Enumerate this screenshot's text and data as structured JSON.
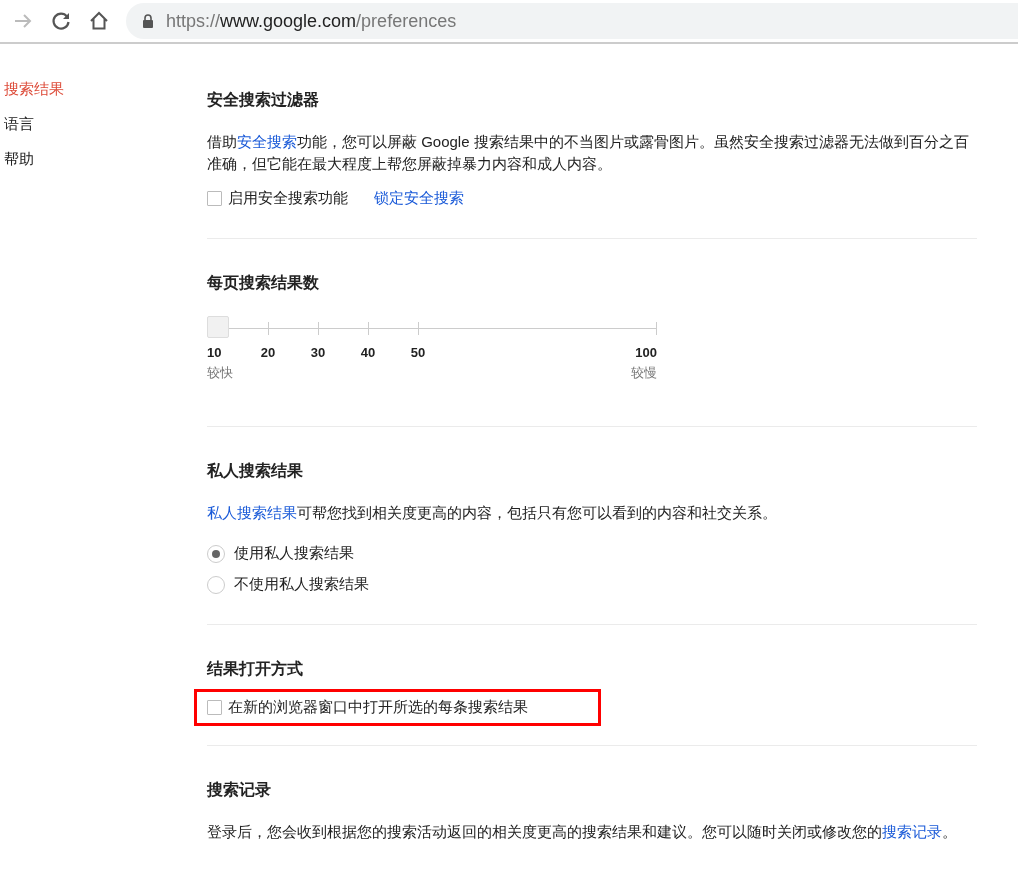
{
  "browser": {
    "forward_disabled": true,
    "url": "https://www.google.com/preferences"
  },
  "sidebar": {
    "items": [
      {
        "label": "搜索结果",
        "selected": true
      },
      {
        "label": "语言",
        "selected": false
      },
      {
        "label": "帮助",
        "selected": false
      }
    ]
  },
  "sections": [
    {
      "title": "安全搜索过滤器",
      "blocks": [
        {
          "kind": "paragraph",
          "before": "借助",
          "link": "安全搜索",
          "after": "功能，您可以屏蔽 Google 搜索结果中的不当图片或露骨图片。虽然安全搜索过滤器无法做到百分之百准确，但它能在最大程度上帮您屏蔽掉暴力内容和成人内容。"
        },
        {
          "kind": "checkbox",
          "label": "启用安全搜索功能",
          "checked": false,
          "highlighted": false,
          "link": "锁定安全搜索"
        }
      ]
    },
    {
      "title": "每页搜索结果数",
      "blocks": [
        {
          "kind": "slider",
          "level": 0,
          "ticks": [
            "10",
            "20",
            "30",
            "40",
            "50",
            "100"
          ],
          "low_label": "较快",
          "high_label": "较慢"
        }
      ]
    },
    {
      "title": "私人搜索结果",
      "blocks": [
        {
          "kind": "paragraph",
          "link": "私人搜索结果",
          "after": "可帮您找到相关度更高的内容，包括只有您可以看到的内容和社交关系。"
        },
        {
          "kind": "radio_group",
          "options": [
            {
              "label": "使用私人搜索结果",
              "selected": true
            },
            {
              "label": "不使用私人搜索结果",
              "selected": false
            }
          ]
        }
      ]
    },
    {
      "title": "结果打开方式",
      "blocks": [
        {
          "kind": "checkbox",
          "label": "在新的浏览器窗口中打开所选的每条搜索结果",
          "checked": false,
          "highlighted": true
        }
      ]
    },
    {
      "title": "搜索记录",
      "blocks": [
        {
          "kind": "paragraph",
          "before": "登录后，您会收到根据您的搜索活动返回的相关度更高的搜索结果和建议。您可以随时关闭或修改您的",
          "link": "搜索记录",
          "after": "。"
        }
      ]
    }
  ]
}
